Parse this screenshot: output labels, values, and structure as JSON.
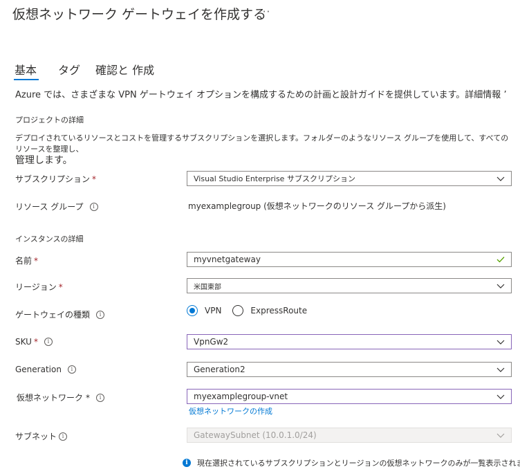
{
  "page": {
    "title": "仮想ネットワーク ゲートウェイを作成する",
    "more": "···"
  },
  "tabs": [
    {
      "label": "基本"
    },
    {
      "label": "タグ"
    },
    {
      "label": "確認と 作成"
    }
  ],
  "intro": "Azure では、さまざまな VPN ゲートウェイ オプションを構成するための計画と設計ガイドを提供しています。詳細情報 ’",
  "project": {
    "heading": "プロジェクトの詳細",
    "description_line1": "デプロイされているリソースとコストを管理するサブスクリプションを選択します。フォルダーのようなリソース グループを使用して、すべてのリソースを整理し、",
    "description_line2": "管理します。",
    "subscription_label": "サブスクリプション",
    "subscription_value": "Visual Studio Enterprise サブスクリプション",
    "resource_group_label": "リソース グループ",
    "resource_group_value": "myexamplegroup (仮想ネットワークのリソース グループから派生)"
  },
  "instance": {
    "heading": "インスタンスの詳細",
    "name_label": "名前",
    "name_value": "myvnetgateway",
    "region_label": "リージョン",
    "region_value": "米国東部",
    "gateway_type_label": "ゲートウェイの種類",
    "gateway_type_options": [
      "VPN",
      "ExpressRoute"
    ],
    "gateway_type_selected": "VPN",
    "sku_label": "SKU",
    "sku_value": "VpnGw2",
    "generation_label": "Generation",
    "generation_value": "Generation2",
    "vnet_label": "仮想ネットワーク",
    "vnet_value": "myexamplegroup-vnet",
    "create_vnet_link": "仮想ネットワークの作成",
    "subnet_label": "サブネット",
    "subnet_value": "GatewaySubnet (10.0.1.0/24)"
  },
  "required_mark": "*",
  "info_note": "現在選択されているサブスクリプションとリージョンの仮想ネットワークのみが一覧表示されます。",
  "colors": {
    "accent": "#0078d4",
    "focus_border": "#8764b8",
    "required": "#a4262c",
    "valid_check": "#57a300"
  }
}
